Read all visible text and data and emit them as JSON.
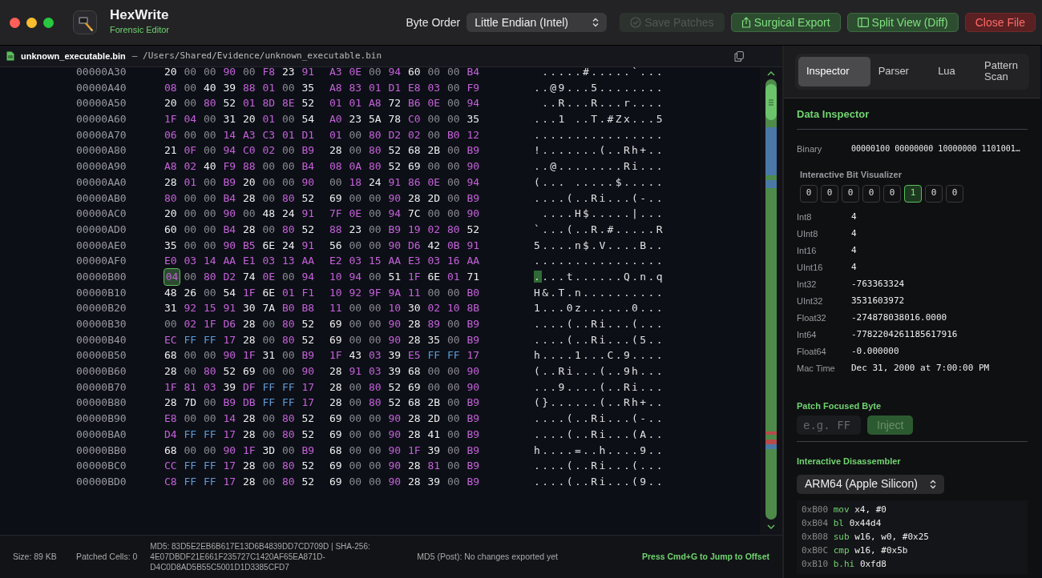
{
  "app": {
    "name": "HexWrite",
    "subtitle": "Forensic Editor"
  },
  "toolbar": {
    "byte_order_label": "Byte Order",
    "byte_order": "Little Endian (Intel)",
    "buttons": [
      {
        "label": "Save Patches",
        "kind": "save",
        "disabled": true
      },
      {
        "label": "Surgical Export",
        "kind": "export",
        "disabled": false
      },
      {
        "label": "Split View (Diff)",
        "kind": "split",
        "disabled": false
      },
      {
        "label": "Close File",
        "kind": "close",
        "disabled": false
      }
    ]
  },
  "file_bar": {
    "file_name": "unknown_executable.bin",
    "path": "— /Users/Shared/Evidence/unknown_executable.bin"
  },
  "hex_view": {
    "rows": [
      {
        "offset": "00000A30",
        "bytes": [
          "20",
          "00",
          "00",
          "90",
          "00",
          "F8",
          "23",
          "91",
          "A3",
          "0E",
          "00",
          "94",
          "60",
          "00",
          "00",
          "B4"
        ],
        "ascii": " .....#.....`...",
        "focused": false
      },
      {
        "offset": "00000A40",
        "bytes": [
          "08",
          "00",
          "40",
          "39",
          "88",
          "01",
          "00",
          "35",
          "A8",
          "83",
          "01",
          "D1",
          "E8",
          "03",
          "00",
          "F9"
        ],
        "ascii": "..@9...5........",
        "focused": false
      },
      {
        "offset": "00000A50",
        "bytes": [
          "20",
          "00",
          "80",
          "52",
          "01",
          "8D",
          "8E",
          "52",
          "01",
          "01",
          "A8",
          "72",
          "B6",
          "0E",
          "00",
          "94"
        ],
        "ascii": " ..R...R...r....",
        "focused": false
      },
      {
        "offset": "00000A60",
        "bytes": [
          "1F",
          "04",
          "00",
          "31",
          "20",
          "01",
          "00",
          "54",
          "A0",
          "23",
          "5A",
          "78",
          "C0",
          "00",
          "00",
          "35"
        ],
        "ascii": "...1 ..T.#Zx...5",
        "focused": false
      },
      {
        "offset": "00000A70",
        "bytes": [
          "06",
          "00",
          "00",
          "14",
          "A3",
          "C3",
          "01",
          "D1",
          "01",
          "00",
          "80",
          "D2",
          "02",
          "00",
          "B0",
          "12"
        ],
        "ascii": "................",
        "focused": false
      },
      {
        "offset": "00000A80",
        "bytes": [
          "21",
          "0F",
          "00",
          "94",
          "C0",
          "02",
          "00",
          "B9",
          "28",
          "00",
          "80",
          "52",
          "68",
          "2B",
          "00",
          "B9"
        ],
        "ascii": "!.......(..Rh+..",
        "focused": false
      },
      {
        "offset": "00000A90",
        "bytes": [
          "A8",
          "02",
          "40",
          "F9",
          "88",
          "00",
          "00",
          "B4",
          "08",
          "0A",
          "80",
          "52",
          "69",
          "00",
          "00",
          "90"
        ],
        "ascii": "..@........Ri...",
        "focused": false
      },
      {
        "offset": "00000AA0",
        "bytes": [
          "28",
          "01",
          "00",
          "B9",
          "20",
          "00",
          "00",
          "90",
          "00",
          "18",
          "24",
          "91",
          "86",
          "0E",
          "00",
          "94"
        ],
        "ascii": "(... .....$.....",
        "focused": false
      },
      {
        "offset": "00000AB0",
        "bytes": [
          "80",
          "00",
          "00",
          "B4",
          "28",
          "00",
          "80",
          "52",
          "69",
          "00",
          "00",
          "90",
          "28",
          "2D",
          "00",
          "B9"
        ],
        "ascii": "....(..Ri...(-..",
        "focused": false
      },
      {
        "offset": "00000AC0",
        "bytes": [
          "20",
          "00",
          "00",
          "90",
          "00",
          "48",
          "24",
          "91",
          "7F",
          "0E",
          "00",
          "94",
          "7C",
          "00",
          "00",
          "90"
        ],
        "ascii": " ....H$.....|...",
        "focused": false
      },
      {
        "offset": "00000AD0",
        "bytes": [
          "60",
          "00",
          "00",
          "B4",
          "28",
          "00",
          "80",
          "52",
          "88",
          "23",
          "00",
          "B9",
          "19",
          "02",
          "80",
          "52"
        ],
        "ascii": "`...(..R.#.....R",
        "focused": false
      },
      {
        "offset": "00000AE0",
        "bytes": [
          "35",
          "00",
          "00",
          "90",
          "B5",
          "6E",
          "24",
          "91",
          "56",
          "00",
          "00",
          "90",
          "D6",
          "42",
          "0B",
          "91"
        ],
        "ascii": "5....n$.V....B..",
        "focused": false
      },
      {
        "offset": "00000AF0",
        "bytes": [
          "E0",
          "03",
          "14",
          "AA",
          "E1",
          "03",
          "13",
          "AA",
          "E2",
          "03",
          "15",
          "AA",
          "E3",
          "03",
          "16",
          "AA"
        ],
        "ascii": "................",
        "focused": false
      },
      {
        "offset": "00000B00",
        "bytes": [
          "04",
          "00",
          "80",
          "D2",
          "74",
          "0E",
          "00",
          "94",
          "10",
          "94",
          "00",
          "51",
          "1F",
          "6E",
          "01",
          "71"
        ],
        "ascii": "....t......Q.n.q",
        "focused": true
      },
      {
        "offset": "00000B10",
        "bytes": [
          "48",
          "26",
          "00",
          "54",
          "1F",
          "6E",
          "01",
          "F1",
          "10",
          "92",
          "9F",
          "9A",
          "11",
          "00",
          "00",
          "B0"
        ],
        "ascii": "H&.T.n..........",
        "focused": false
      },
      {
        "offset": "00000B20",
        "bytes": [
          "31",
          "92",
          "15",
          "91",
          "30",
          "7A",
          "B0",
          "B8",
          "11",
          "00",
          "00",
          "10",
          "30",
          "02",
          "10",
          "8B"
        ],
        "ascii": "1...0z......0...",
        "focused": false
      },
      {
        "offset": "00000B30",
        "bytes": [
          "00",
          "02",
          "1F",
          "D6",
          "28",
          "00",
          "80",
          "52",
          "69",
          "00",
          "00",
          "90",
          "28",
          "89",
          "00",
          "B9"
        ],
        "ascii": "....(..Ri...(...",
        "focused": false
      },
      {
        "offset": "00000B40",
        "bytes": [
          "EC",
          "FF",
          "FF",
          "17",
          "28",
          "00",
          "80",
          "52",
          "69",
          "00",
          "00",
          "90",
          "28",
          "35",
          "00",
          "B9"
        ],
        "ascii": "....(..Ri...(5..",
        "focused": false
      },
      {
        "offset": "00000B50",
        "bytes": [
          "68",
          "00",
          "00",
          "90",
          "1F",
          "31",
          "00",
          "B9",
          "1F",
          "43",
          "03",
          "39",
          "E5",
          "FF",
          "FF",
          "17"
        ],
        "ascii": "h....1...C.9....",
        "focused": false
      },
      {
        "offset": "00000B60",
        "bytes": [
          "28",
          "00",
          "80",
          "52",
          "69",
          "00",
          "00",
          "90",
          "28",
          "91",
          "03",
          "39",
          "68",
          "00",
          "00",
          "90"
        ],
        "ascii": "(..Ri...(..9h...",
        "focused": false
      },
      {
        "offset": "00000B70",
        "bytes": [
          "1F",
          "81",
          "03",
          "39",
          "DF",
          "FF",
          "FF",
          "17",
          "28",
          "00",
          "80",
          "52",
          "69",
          "00",
          "00",
          "90"
        ],
        "ascii": "...9....(..Ri...",
        "focused": false
      },
      {
        "offset": "00000B80",
        "bytes": [
          "28",
          "7D",
          "00",
          "B9",
          "DB",
          "FF",
          "FF",
          "17",
          "28",
          "00",
          "80",
          "52",
          "68",
          "2B",
          "00",
          "B9"
        ],
        "ascii": "(}......(..Rh+..",
        "focused": false
      },
      {
        "offset": "00000B90",
        "bytes": [
          "E8",
          "00",
          "00",
          "14",
          "28",
          "00",
          "80",
          "52",
          "69",
          "00",
          "00",
          "90",
          "28",
          "2D",
          "00",
          "B9"
        ],
        "ascii": "....(..Ri...(-..",
        "focused": false
      },
      {
        "offset": "00000BA0",
        "bytes": [
          "D4",
          "FF",
          "FF",
          "17",
          "28",
          "00",
          "80",
          "52",
          "69",
          "00",
          "00",
          "90",
          "28",
          "41",
          "00",
          "B9"
        ],
        "ascii": "....(..Ri...(A..",
        "focused": false
      },
      {
        "offset": "00000BB0",
        "bytes": [
          "68",
          "00",
          "00",
          "90",
          "1F",
          "3D",
          "00",
          "B9",
          "68",
          "00",
          "00",
          "90",
          "1F",
          "39",
          "00",
          "B9"
        ],
        "ascii": "h....=..h....9..",
        "focused": false
      },
      {
        "offset": "00000BC0",
        "bytes": [
          "CC",
          "FF",
          "FF",
          "17",
          "28",
          "00",
          "80",
          "52",
          "69",
          "00",
          "00",
          "90",
          "28",
          "81",
          "00",
          "B9"
        ],
        "ascii": "....(..Ri...(...",
        "focused": false
      },
      {
        "offset": "00000BD0",
        "bytes": [
          "C8",
          "FF",
          "FF",
          "17",
          "28",
          "00",
          "80",
          "52",
          "69",
          "00",
          "00",
          "90",
          "28",
          "39",
          "00",
          "B9"
        ],
        "ascii": "....(..Ri...(9..",
        "focused": false
      }
    ]
  },
  "side_panel": {
    "tabs": [
      {
        "label": "Inspector",
        "selected": true
      },
      {
        "label": "Parser",
        "selected": false
      },
      {
        "label": "Lua",
        "selected": false
      },
      {
        "label": "Pattern Scan",
        "selected": false
      }
    ],
    "inspector": {
      "title": "Data Inspector",
      "binary_label": "Binary",
      "binary": "00000100 00000000 10000000 1101001…",
      "bits_label": "Interactive Bit Visualizer",
      "bits": [
        {
          "value": "0",
          "set": false
        },
        {
          "value": "0",
          "set": false
        },
        {
          "value": "0",
          "set": false
        },
        {
          "value": "0",
          "set": false
        },
        {
          "value": "0",
          "set": false
        },
        {
          "value": "1",
          "set": true
        },
        {
          "value": "0",
          "set": false
        },
        {
          "value": "0",
          "set": false
        }
      ],
      "fields": [
        {
          "label": "Int8",
          "value": "4"
        },
        {
          "label": "UInt8",
          "value": "4"
        },
        {
          "label": "Int16",
          "value": "4"
        },
        {
          "label": "UInt16",
          "value": "4"
        },
        {
          "label": "Int32",
          "value": "-763363324"
        },
        {
          "label": "UInt32",
          "value": "3531603972"
        },
        {
          "label": "Float32",
          "value": "-274878038016.0000"
        },
        {
          "label": "Int64",
          "value": "-7782204261185617916"
        },
        {
          "label": "Float64",
          "value": "-0.000000"
        },
        {
          "label": "Mac Time",
          "value": "Dec 31, 2000 at 7:00:00 PM"
        }
      ]
    },
    "patch": {
      "title": "Patch Focused Byte",
      "placeholder": "e.g. FF",
      "button": "Inject"
    },
    "disassembler": {
      "title": "Interactive Disassembler",
      "architecture": "ARM64 (Apple Silicon)",
      "lines": [
        {
          "address": "0xB00",
          "mnemonic": "mov",
          "operands": "x4, #0"
        },
        {
          "address": "0xB04",
          "mnemonic": "bl",
          "operands": "0x44d4"
        },
        {
          "address": "0xB08",
          "mnemonic": "sub",
          "operands": "w16, w0, #0x25"
        },
        {
          "address": "0xB0C",
          "mnemonic": "cmp",
          "operands": "w16, #0x5b"
        },
        {
          "address": "0xB10",
          "mnemonic": "b.hi",
          "operands": "0xfd8"
        }
      ]
    }
  },
  "status_bar": {
    "size": "Size: 89 KB",
    "patched": "Patched Cells: 0",
    "hashes": "MD5: 83D5E2EB6B617E13D6B4839DD7CD709D | SHA-256: 4E07DBDF21E661F235727C1420AF65EA871D-D4C0D8AD5B55C5001D1D3385CFD7",
    "post": "MD5 (Post): No changes exported yet",
    "hint": "Press Cmd+G to Jump to Offset"
  }
}
